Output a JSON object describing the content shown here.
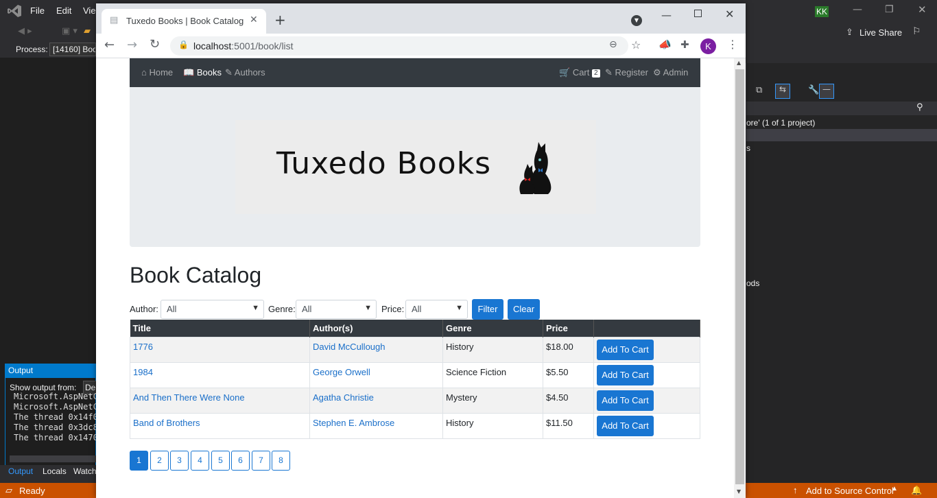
{
  "vs": {
    "menu": [
      "File",
      "Edit",
      "Vie"
    ],
    "process_label": "Process:",
    "process_value": "[14160] Boo",
    "user_initials": "KK",
    "live_share": "Live Share",
    "solution_line1": "ore' (1 of 1 project)",
    "solution_line2": "s",
    "solution_line3": "ods",
    "output_title": "Output",
    "output_show_from": "Show output from:",
    "output_source": "De",
    "output_lines": [
      "Microsoft.AspNetC",
      "Microsoft.AspNetC",
      "The thread 0x14f0",
      "The thread 0x3dc8",
      "The thread 0x1470"
    ],
    "bottom_tabs": [
      "Output",
      "Locals",
      "Watch"
    ],
    "status_ready": "Ready",
    "status_source_control": "Add to Source Control",
    "notifications": "1"
  },
  "browser": {
    "tab_title": "Tuxedo Books | Book Catalog",
    "url_host": "localhost",
    "url_rest": ":5001/book/list",
    "profile_initial": "K"
  },
  "site": {
    "nav": {
      "home": "Home",
      "books": "Books",
      "authors": "Authors",
      "cart": "Cart",
      "cart_count": "2",
      "register": "Register",
      "admin": "Admin"
    },
    "logo_text": "Tuxedo Books",
    "heading": "Book Catalog",
    "filters": {
      "author_label": "Author:",
      "author_value": "All",
      "genre_label": "Genre:",
      "genre_value": "All",
      "price_label": "Price:",
      "price_value": "All",
      "filter_button": "Filter",
      "clear_button": "Clear"
    },
    "table": {
      "headers": [
        "Title",
        "Author(s)",
        "Genre",
        "Price",
        ""
      ],
      "rows": [
        {
          "title": "1776",
          "author": "David McCullough",
          "genre": "History",
          "price": "$18.00",
          "action": "Add To Cart"
        },
        {
          "title": "1984",
          "author": "George Orwell",
          "genre": "Science Fiction",
          "price": "$5.50",
          "action": "Add To Cart"
        },
        {
          "title": "And Then There Were None",
          "author": "Agatha Christie",
          "genre": "Mystery",
          "price": "$4.50",
          "action": "Add To Cart"
        },
        {
          "title": "Band of Brothers",
          "author": "Stephen E. Ambrose",
          "genre": "History",
          "price": "$11.50",
          "action": "Add To Cart"
        }
      ]
    },
    "pages": [
      "1",
      "2",
      "3",
      "4",
      "5",
      "6",
      "7",
      "8"
    ],
    "active_page": "1"
  },
  "colors": {
    "accent": "#1976d2",
    "navbar": "#343a40",
    "vs_status": "#ca5100",
    "jumbotron": "#e9ecef"
  }
}
